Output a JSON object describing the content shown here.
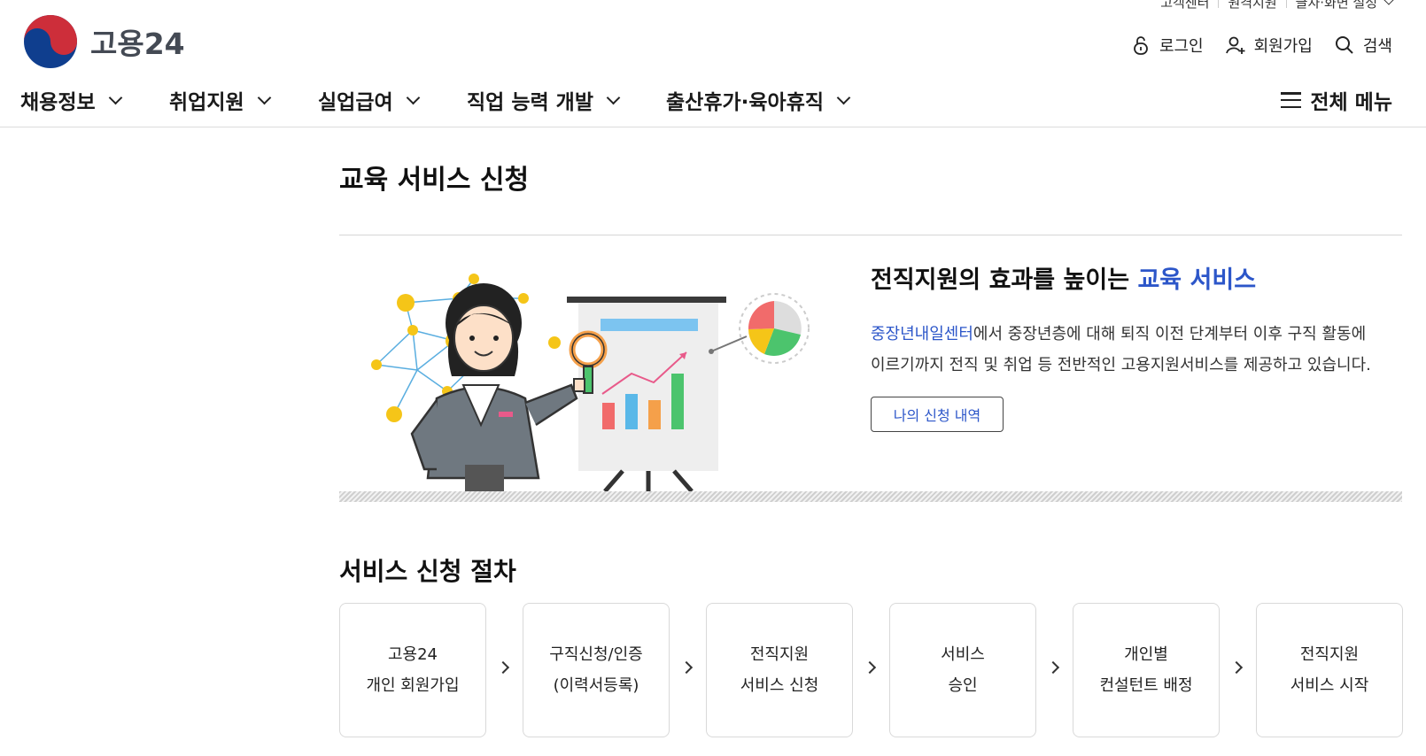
{
  "util_links": {
    "customer_center": "고객센터",
    "remote_support": "원격지원",
    "text_screen_settings": "글자·화면 설정"
  },
  "logo": {
    "text": "고용24"
  },
  "member": {
    "login": "로그인",
    "signup": "회원가입",
    "search": "검색"
  },
  "gnb": {
    "items": [
      "채용정보",
      "취업지원",
      "실업급여",
      "직업 능력 개발",
      "출산휴가·육아휴직"
    ],
    "all_menu": "전체 메뉴"
  },
  "page": {
    "title": "교육 서비스 신청"
  },
  "intro": {
    "heading_prefix": "전직지원의 효과를 높이는 ",
    "heading_highlight": "교육 서비스",
    "desc_link": "중장년내일센터",
    "desc_line1_rest": "에서 중장년층에 대해 퇴직 이전 단계부터 이후 구직 활동에",
    "desc_line2": "이르기까지 전직 및 취업 등 전반적인 고용지원서비스를 제공하고 있습니다.",
    "history_button": "나의 신청 내역"
  },
  "process": {
    "title": "서비스 신청 절차",
    "steps": [
      {
        "line1": "고용24",
        "line2": "개인 회원가입"
      },
      {
        "line1": "구직신청/인증",
        "line2": "(이력서등록)"
      },
      {
        "line1": "전직지원",
        "line2": "서비스 신청"
      },
      {
        "line1": "서비스",
        "line2": "승인"
      },
      {
        "line1": "개인별",
        "line2": "컨설턴트 배정"
      },
      {
        "line1": "전직지원",
        "line2": "서비스 시작"
      }
    ]
  },
  "colors": {
    "accent_blue": "#2c56c9",
    "logo_red": "#cd2e3a",
    "logo_blue": "#0f3e8e"
  }
}
